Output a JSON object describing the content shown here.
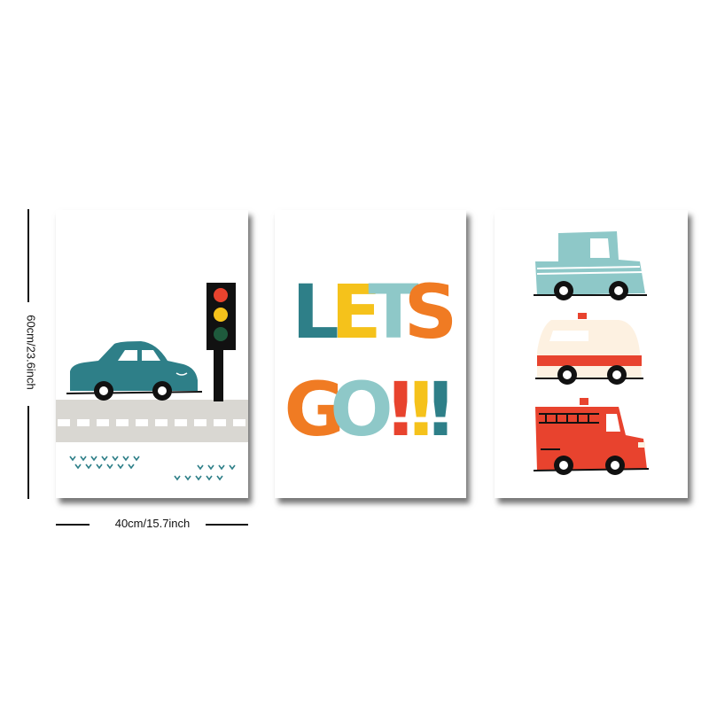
{
  "dimensions": {
    "height_label": "60cm/23.6inch",
    "width_label": "40cm/15.7inch"
  },
  "center_print": {
    "line1": [
      "L",
      "E",
      "T",
      "S"
    ],
    "line2": [
      "G",
      "O",
      "!",
      "!",
      "!"
    ]
  },
  "colors": {
    "teal": "#2e7f88",
    "yellow": "#f5c21b",
    "orange": "#f07b23",
    "red": "#e8432e",
    "light_teal": "#8ec8c8",
    "cream": "#fdf1e1",
    "road": "#d9d7d2",
    "black": "#111111"
  },
  "icons": [
    "car-icon",
    "traffic-light-icon",
    "pickup-truck-icon",
    "ambulance-icon",
    "fire-truck-icon",
    "grass-icon"
  ]
}
